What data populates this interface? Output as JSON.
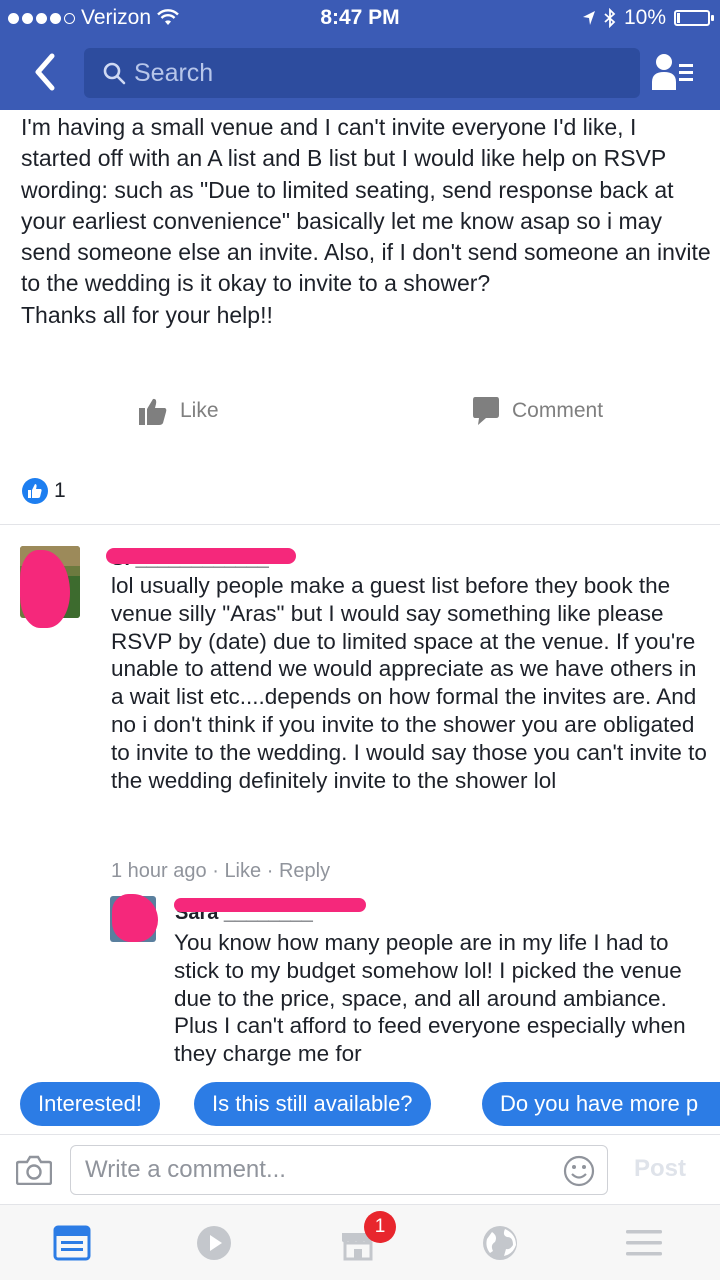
{
  "status_bar": {
    "carrier": "Verizon",
    "time": "8:47 PM",
    "battery": "10%",
    "battery_level": 0.1
  },
  "nav": {
    "search_placeholder": "Search"
  },
  "post": {
    "paragraphs": [
      "I'm having a small venue and I can't invite everyone I'd like, I started off with an A list and B list but I would like help on RSVP wording: such as \"Due to limited seating, send response back at your earliest convenience\" basically let me know asap so i may send someone else an invite. Also, if I don't send someone an invite to the wedding is it okay to invite to a shower?",
      "Thanks all for your help!!"
    ],
    "like_label": "Like",
    "comment_label": "Comment",
    "reaction_count": "1"
  },
  "comments": [
    {
      "text": "lol usually people make a guest list before they book the venue silly \"Aras\" but I would say something like please RSVP by (date) due to limited space at the venue. If you're unable to attend we would appreciate as we have others in a wait list etc....depends on how formal the invites are. And no i don't think if you invite to the shower you are obligated to invite to the wedding. I would say those you can't invite to the wedding definitely invite to the shower lol",
      "time": "1 hour ago",
      "like": "Like",
      "reply": "Reply",
      "sep": "·"
    },
    {
      "text": "You know how many people are in my life I had to stick to my budget somehow lol! I picked the venue due to the price, space, and all around ambiance. Plus I can't afford to feed everyone especially when they charge me for"
    }
  ],
  "quick_replies": [
    "Interested!",
    "Is this still available?",
    "Do you have more p"
  ],
  "composer": {
    "placeholder": "Write a comment...",
    "post_label": "Post"
  },
  "tabbar": {
    "marketplace_badge": "1"
  },
  "colors": {
    "header": "#3b5bb5",
    "chip": "#2c7ce5",
    "redaction": "#f5287b"
  }
}
